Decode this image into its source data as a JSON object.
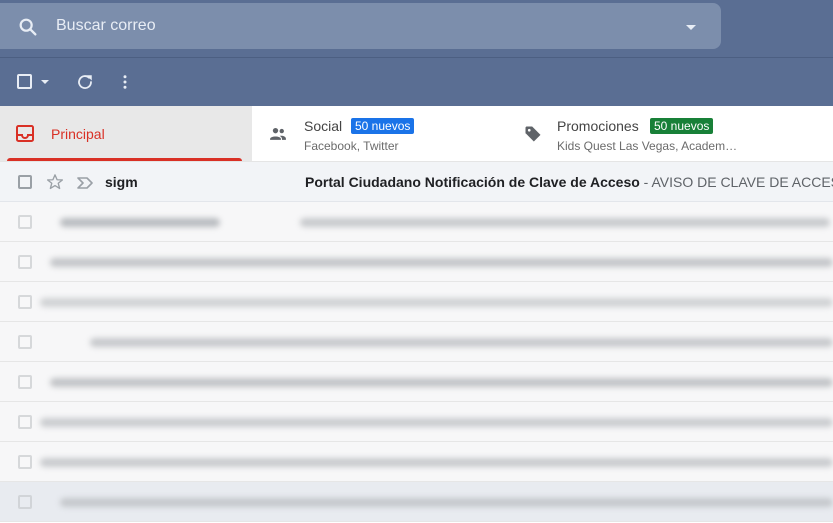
{
  "search": {
    "placeholder": "Buscar correo"
  },
  "toolbar": {
    "select_all": "select-all",
    "refresh": "refresh",
    "more": "more"
  },
  "tabs": {
    "primary": {
      "label": "Principal",
      "color": "#d93025"
    },
    "social": {
      "label": "Social",
      "badge": "50 nuevos",
      "badge_color": "#1a73e8",
      "sub": "Facebook, Twitter"
    },
    "promotions": {
      "label": "Promociones",
      "badge": "50 nuevos",
      "badge_color": "#188038",
      "sub": "Kids Quest Las Vegas, Academ…"
    }
  },
  "emails": [
    {
      "sender": "sigm",
      "subject": "Portal Ciudadano Notificación de Clave de Acceso",
      "snippet": " - AVISO DE CLAVE DE ACCESO"
    }
  ],
  "colors": {
    "topbar": "#5a6e93",
    "search_box": "#7c8eac",
    "accent": "#d93025"
  }
}
